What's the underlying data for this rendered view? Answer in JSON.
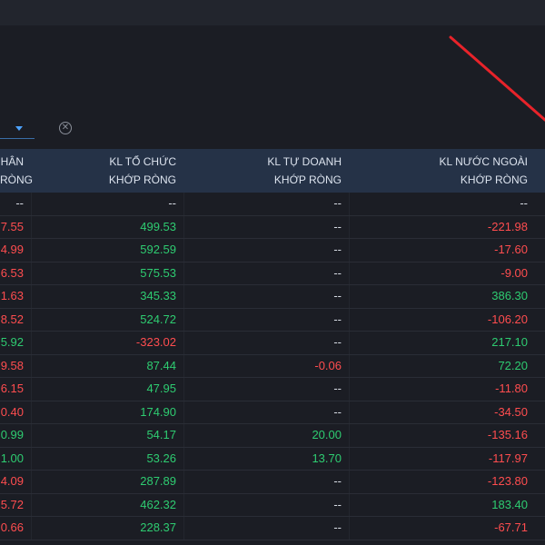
{
  "colors": {
    "positive": "#2ecc71",
    "negative": "#ff4d4f",
    "neutral": "#d6dbe3",
    "header_bg": "#253247",
    "annotation": "#e8232a"
  },
  "filter": {
    "dropdown_icon": "chevron-down-icon",
    "clear_icon": "circle-x-icon",
    "clear_glyph": "✕"
  },
  "table": {
    "headers": [
      {
        "line1": "HÂN",
        "line2": "RÒNG"
      },
      {
        "line1": "KL TỔ CHỨC",
        "line2": "KHỚP RÒNG"
      },
      {
        "line1": "KL TỰ DOANH",
        "line2": "KHỚP RÒNG"
      },
      {
        "line1": "KL NƯỚC NGOÀI",
        "line2": "KHỚP RÒNG"
      }
    ],
    "rows": [
      [
        "--",
        "--",
        "--",
        "--"
      ],
      [
        "7.55",
        "499.53",
        "--",
        "-221.98"
      ],
      [
        "4.99",
        "592.59",
        "--",
        "-17.60"
      ],
      [
        "6.53",
        "575.53",
        "--",
        "-9.00"
      ],
      [
        "1.63",
        "345.33",
        "--",
        "386.30"
      ],
      [
        "8.52",
        "524.72",
        "--",
        "-106.20"
      ],
      [
        "5.92",
        "-323.02",
        "--",
        "217.10"
      ],
      [
        "9.58",
        "87.44",
        "-0.06",
        "72.20"
      ],
      [
        "6.15",
        "47.95",
        "--",
        "-11.80"
      ],
      [
        "0.40",
        "174.90",
        "--",
        "-34.50"
      ],
      [
        "0.99",
        "54.17",
        "20.00",
        "-135.16"
      ],
      [
        "1.00",
        "53.26",
        "13.70",
        "-117.97"
      ],
      [
        "4.09",
        "287.89",
        "--",
        "-123.80"
      ],
      [
        "5.72",
        "462.32",
        "--",
        "183.40"
      ],
      [
        "0.66",
        "228.37",
        "--",
        "-67.71"
      ]
    ],
    "row_colors": [
      [
        "neu",
        "neu",
        "neu",
        "neu"
      ],
      [
        "neg",
        "pos",
        "neu",
        "neg"
      ],
      [
        "neg",
        "pos",
        "neu",
        "neg"
      ],
      [
        "neg",
        "pos",
        "neu",
        "neg"
      ],
      [
        "neg",
        "pos",
        "neu",
        "pos"
      ],
      [
        "neg",
        "pos",
        "neu",
        "neg"
      ],
      [
        "pos",
        "neg",
        "neu",
        "pos"
      ],
      [
        "neg",
        "pos",
        "neg",
        "pos"
      ],
      [
        "neg",
        "pos",
        "neu",
        "neg"
      ],
      [
        "neg",
        "pos",
        "neu",
        "neg"
      ],
      [
        "pos",
        "pos",
        "pos",
        "neg"
      ],
      [
        "pos",
        "pos",
        "pos",
        "neg"
      ],
      [
        "neg",
        "pos",
        "neu",
        "neg"
      ],
      [
        "neg",
        "pos",
        "neu",
        "pos"
      ],
      [
        "neg",
        "pos",
        "neu",
        "neg"
      ]
    ]
  }
}
